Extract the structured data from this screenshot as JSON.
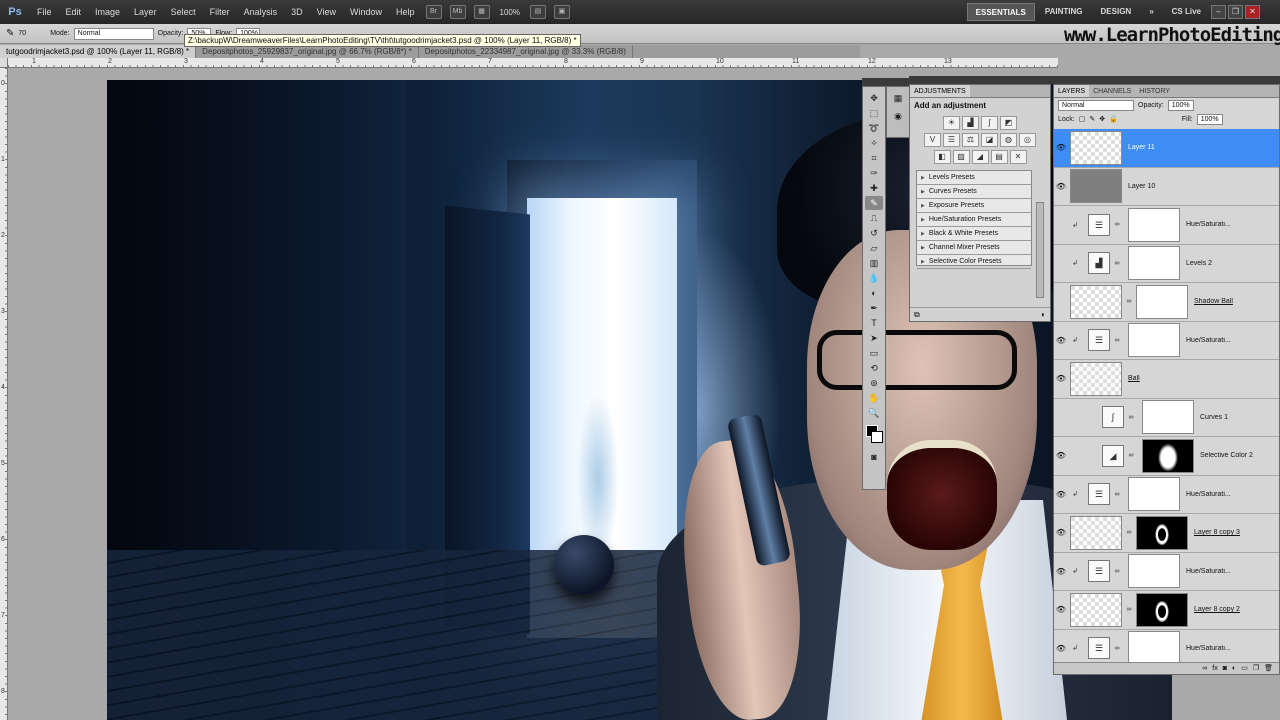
{
  "menubar": {
    "logo": "Ps",
    "items": [
      "File",
      "Edit",
      "Image",
      "Layer",
      "Select",
      "Filter",
      "Analysis",
      "3D",
      "View",
      "Window",
      "Help"
    ],
    "zoom": "100%",
    "workspaces": [
      "ESSENTIALS",
      "PAINTING",
      "DESIGN"
    ],
    "overflow": "»",
    "cs_live": "CS Live"
  },
  "options": {
    "brush_size": "70",
    "mode_label": "Mode:",
    "mode_value": "Normal",
    "opacity_label": "Opacity:",
    "opacity_value": "50%",
    "flow_label": "Flow:",
    "flow_value": "100%"
  },
  "tooltip": "Z:\\backupW\\DreamweaverFiles\\LearnPhotoEditing\\TV\\tht\\tutgoodrimjacket3.psd @ 100% (Layer 11, RGB/8) *",
  "watermark": "www.LearnPhotoEditing.net",
  "tabs": [
    {
      "label": "tutgoodrimjacket3.psd @ 100% (Layer 11, RGB/8) *"
    },
    {
      "label": "Depositphotos_25929837_original.jpg @ 66.7% (RGB/8*) *"
    },
    {
      "label": "Depositphotos_22334987_original.jpg @ 33.3% (RGB/8)"
    }
  ],
  "ruler_h": [
    "1",
    "2",
    "3",
    "4",
    "5",
    "6",
    "7",
    "8",
    "9",
    "10",
    "11",
    "12",
    "13"
  ],
  "ruler_v": [
    "0",
    "1",
    "2",
    "3",
    "4",
    "5",
    "6",
    "7",
    "8"
  ],
  "adjustments": {
    "tab": "ADJUSTMENTS",
    "title": "Add an adjustment",
    "presets": [
      "Levels Presets",
      "Curves Presets",
      "Exposure Presets",
      "Hue/Saturation Presets",
      "Black & White Presets",
      "Channel Mixer Presets",
      "Selective Color Presets"
    ]
  },
  "layers_panel": {
    "tabs": [
      "LAYERS",
      "CHANNELS",
      "HISTORY"
    ],
    "blend_mode": "Normal",
    "opacity_label": "Opacity:",
    "opacity_value": "100%",
    "lock_label": "Lock:",
    "fill_label": "Fill:",
    "fill_value": "100%",
    "layers": [
      {
        "name": "Layer 11"
      },
      {
        "name": "Layer 10"
      },
      {
        "name": "Hue/Saturati..."
      },
      {
        "name": "Levels 2"
      },
      {
        "name": "Shadow Ball"
      },
      {
        "name": "Hue/Saturati..."
      },
      {
        "name": "Ball"
      },
      {
        "name": "Curves 1"
      },
      {
        "name": "Selective Color 2"
      },
      {
        "name": "Hue/Saturati..."
      },
      {
        "name": "Layer 8 copy 3"
      },
      {
        "name": "Hue/Saturati..."
      },
      {
        "name": "Layer 8 copy 2"
      },
      {
        "name": "Hue/Saturati..."
      }
    ]
  },
  "colors": {
    "selected_layer": "#3d8df5",
    "menubar": "#2e2e2e"
  }
}
